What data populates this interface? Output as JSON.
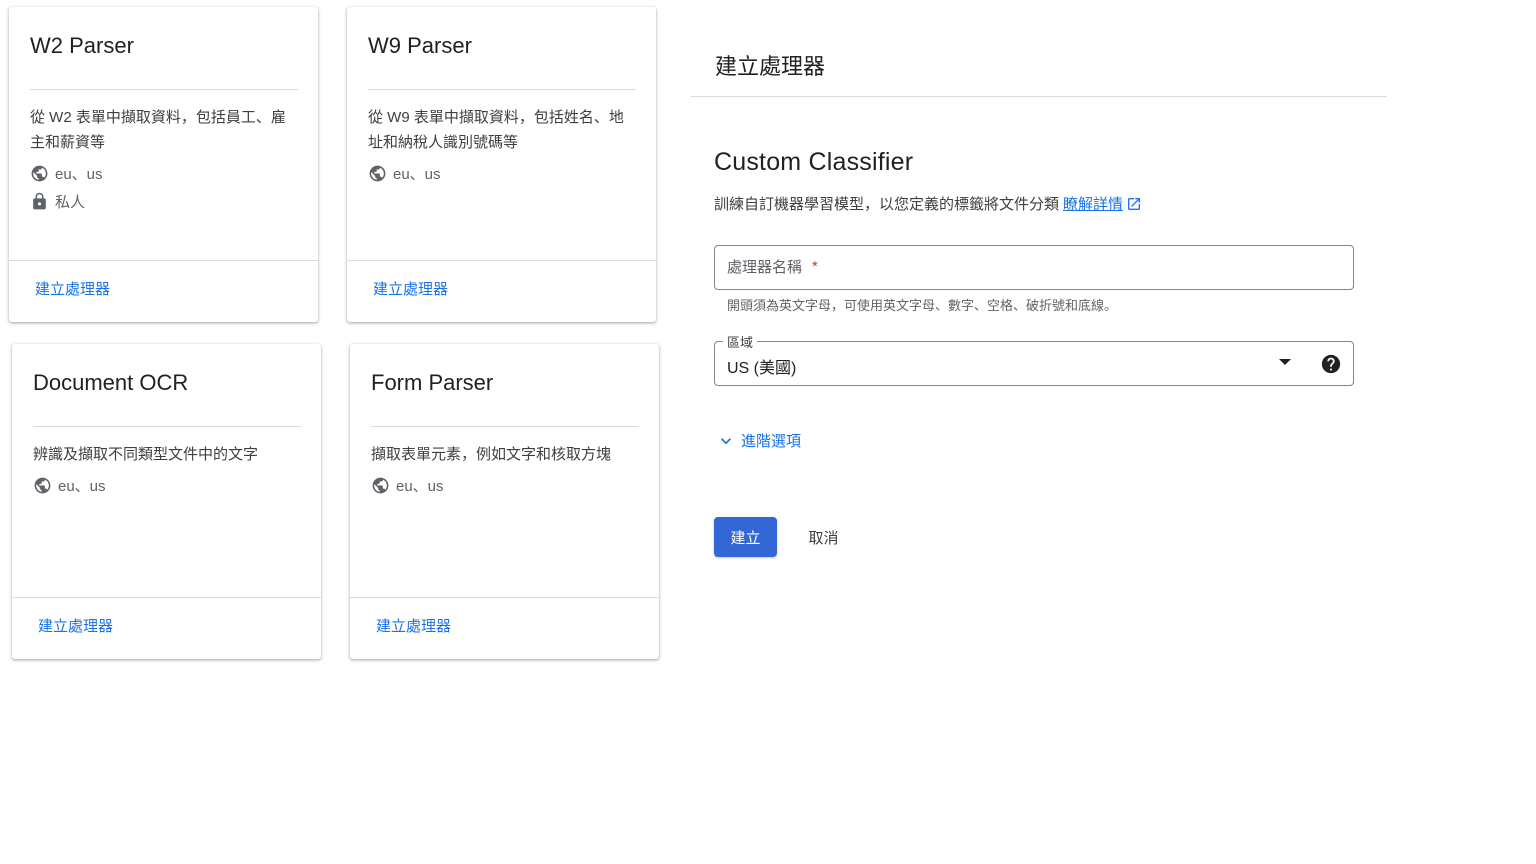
{
  "cards": [
    {
      "title": "W2 Parser",
      "description": "從 W2 表單中擷取資料，包括員工、雇主和薪資等",
      "regions": "eu、us",
      "visibility": "私人",
      "action": "建立處理器"
    },
    {
      "title": "W9 Parser",
      "description": "從 W9 表單中擷取資料，包括姓名、地址和納稅人識別號碼等",
      "regions": "eu、us",
      "action": "建立處理器"
    },
    {
      "title": "Document OCR",
      "description": "辨識及擷取不同類型文件中的文字",
      "regions": "eu、us",
      "action": "建立處理器"
    },
    {
      "title": "Form Parser",
      "description": "擷取表單元素，例如文字和核取方塊",
      "regions": "eu、us",
      "action": "建立處理器"
    }
  ],
  "panel": {
    "title": "建立處理器",
    "processor_type": "Custom Classifier",
    "description": "訓練自訂機器學習模型，以您定義的標籤將文件分類",
    "learn_more": "瞭解詳情",
    "name_field": {
      "placeholder": "處理器名稱",
      "required_mark": "*",
      "value": "",
      "hint": "開頭須為英文字母，可使用英文字母、數字、空格、破折號和底線。"
    },
    "region_field": {
      "label": "區域",
      "value": "US (美國)"
    },
    "advanced_options": "進階選項",
    "create_button": "建立",
    "cancel_button": "取消"
  },
  "colors": {
    "accent": "#1a73e8",
    "primary_button": "#3367d6",
    "required": "#d93025"
  }
}
